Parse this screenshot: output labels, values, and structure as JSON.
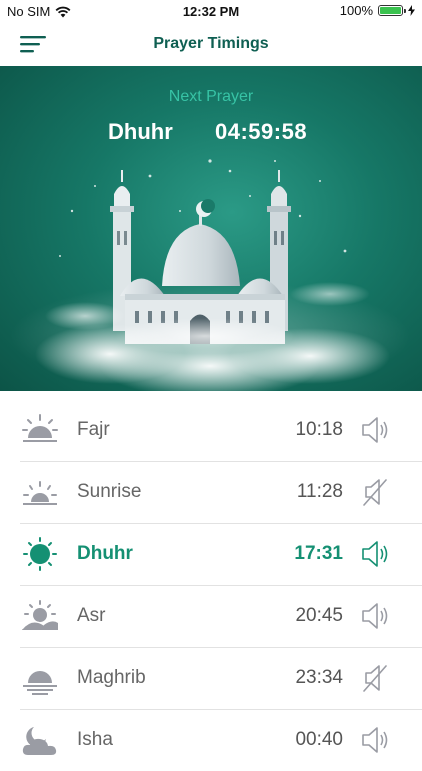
{
  "status_bar": {
    "carrier": "No SIM",
    "time": "12:32 PM",
    "battery": "100%"
  },
  "header": {
    "title": "Prayer Timings"
  },
  "next_prayer": {
    "label": "Next Prayer",
    "name": "Dhuhr",
    "countdown": "04:59:58"
  },
  "colors": {
    "accent": "#159073",
    "header_title": "#0f5f52",
    "hero_bg": "#167766",
    "inactive_icon": "#9a9ca4"
  },
  "prayers": [
    {
      "name": "Fajr",
      "time": "10:18",
      "icon": "sun-horizon-icon",
      "sound": "speaker-on-icon",
      "active": false
    },
    {
      "name": "Sunrise",
      "time": "11:28",
      "icon": "sunrise-icon",
      "sound": "speaker-muted-icon",
      "active": false
    },
    {
      "name": "Dhuhr",
      "time": "17:31",
      "icon": "sun-icon",
      "sound": "speaker-on-icon",
      "active": true
    },
    {
      "name": "Asr",
      "time": "20:45",
      "icon": "sun-over-dunes-icon",
      "sound": "speaker-on-icon",
      "active": false
    },
    {
      "name": "Maghrib",
      "time": "23:34",
      "icon": "sunset-icon",
      "sound": "speaker-muted-icon",
      "active": false
    },
    {
      "name": "Isha",
      "time": "00:40",
      "icon": "moon-cloud-icon",
      "sound": "speaker-on-icon",
      "active": false
    }
  ]
}
